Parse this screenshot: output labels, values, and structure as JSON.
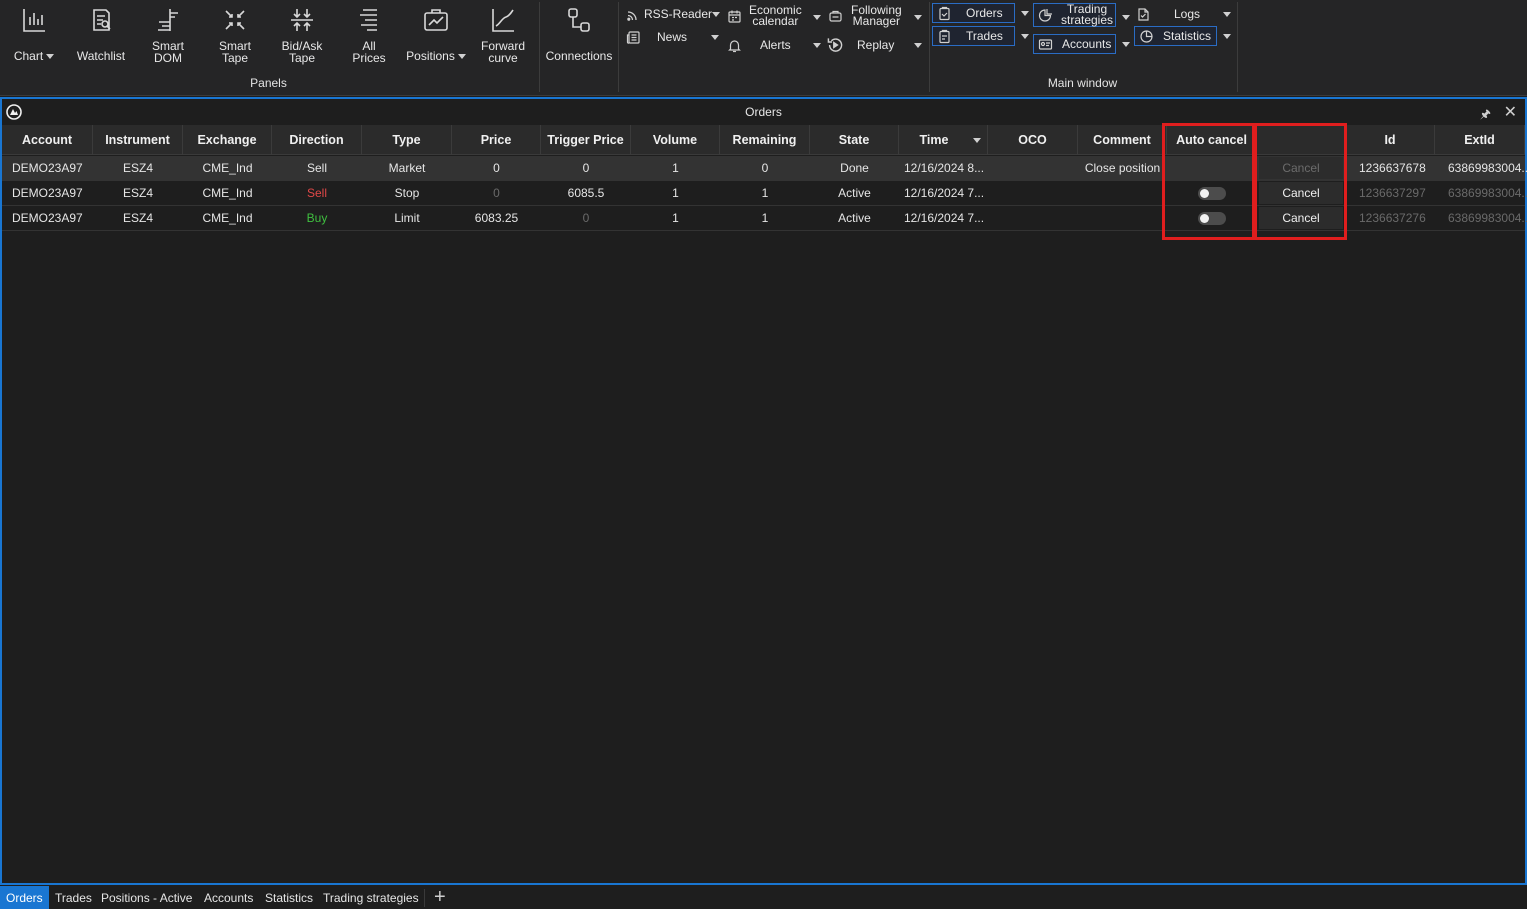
{
  "ribbon": {
    "panels": {
      "group_label": "Panels",
      "chart": "Chart",
      "watchlist": "Watchlist",
      "smart_dom": "Smart\nDOM",
      "smart_tape": "Smart\nTape",
      "bidask_tape": "Bid/Ask\nTape",
      "all_prices": "All\nPrices",
      "positions": "Positions",
      "forward_curve": "Forward\ncurve"
    },
    "connections": "Connections",
    "tools": {
      "rss_reader": "RSS-Reader",
      "news": "News",
      "economic_calendar": "Economic\ncalendar",
      "alerts": "Alerts",
      "following_manager": "Following\nManager",
      "replay": "Replay"
    },
    "main_window": {
      "group_label": "Main window",
      "orders": "Orders",
      "trades": "Trades",
      "trading_strategies": "Trading\nstrategies",
      "accounts": "Accounts",
      "logs": "Logs",
      "statistics": "Statistics"
    }
  },
  "panel": {
    "title": "Orders",
    "columns": [
      "Account",
      "Instrument",
      "Exchange",
      "Direction",
      "Type",
      "Price",
      "Trigger Price",
      "Volume",
      "Remaining",
      "State",
      "Time",
      "OCO",
      "Comment",
      "Auto cancel",
      "",
      "Id",
      "ExtId"
    ],
    "rows": [
      {
        "account": "DEMO23A97",
        "instrument": "ESZ4",
        "exchange": "CME_Ind",
        "direction": "Sell",
        "type": "Market",
        "price": "0",
        "trigger_price": "0",
        "volume": "1",
        "remaining": "0",
        "state": "Done",
        "time": "12/16/2024 8...",
        "oco": "",
        "comment": "Close position",
        "cancel": "Cancel",
        "id": "1236637678",
        "extid": "63869983004..."
      },
      {
        "account": "DEMO23A97",
        "instrument": "ESZ4",
        "exchange": "CME_Ind",
        "direction": "Sell",
        "type": "Stop",
        "price": "0",
        "trigger_price": "6085.5",
        "volume": "1",
        "remaining": "1",
        "state": "Active",
        "time": "12/16/2024 7...",
        "oco": "",
        "comment": "",
        "cancel": "Cancel",
        "id": "1236637297",
        "extid": "63869983004..."
      },
      {
        "account": "DEMO23A97",
        "instrument": "ESZ4",
        "exchange": "CME_Ind",
        "direction": "Buy",
        "type": "Limit",
        "price": "6083.25",
        "trigger_price": "0",
        "volume": "1",
        "remaining": "1",
        "state": "Active",
        "time": "12/16/2024 7...",
        "oco": "",
        "comment": "",
        "cancel": "Cancel",
        "id": "1236637276",
        "extid": "63869983004..."
      }
    ]
  },
  "bottom_tabs": [
    "Orders",
    "Trades",
    "Positions - Active",
    "Accounts",
    "Statistics",
    "Trading strategies"
  ],
  "colors": {
    "accent": "#1976d2",
    "sell": "#e04848",
    "buy": "#3fbf3f",
    "highlight": "#e01e1e"
  }
}
